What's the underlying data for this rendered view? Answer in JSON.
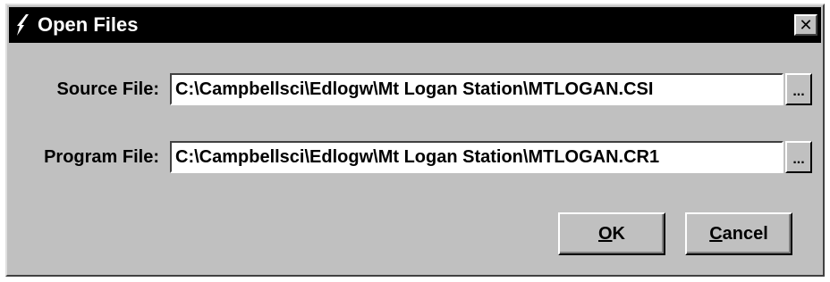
{
  "window": {
    "title": "Open Files",
    "close_glyph": "✕",
    "icon": "lightning-bolt-icon"
  },
  "source": {
    "label": "Source File:",
    "value": "C:\\Campbellsci\\Edlogw\\Mt Logan Station\\MTLOGAN.CSI",
    "browse_label": "..."
  },
  "program": {
    "label": "Program File:",
    "value": "C:\\Campbellsci\\Edlogw\\Mt Logan Station\\MTLOGAN.CR1",
    "browse_label": "..."
  },
  "buttons": {
    "ok_mnemonic": "O",
    "ok_rest": "K",
    "cancel_mnemonic": "C",
    "cancel_rest": "ancel"
  },
  "colors": {
    "face": "#c0c0c0",
    "titlebar": "#000000",
    "title_text": "#ffffff",
    "input_bg": "#ffffff"
  }
}
